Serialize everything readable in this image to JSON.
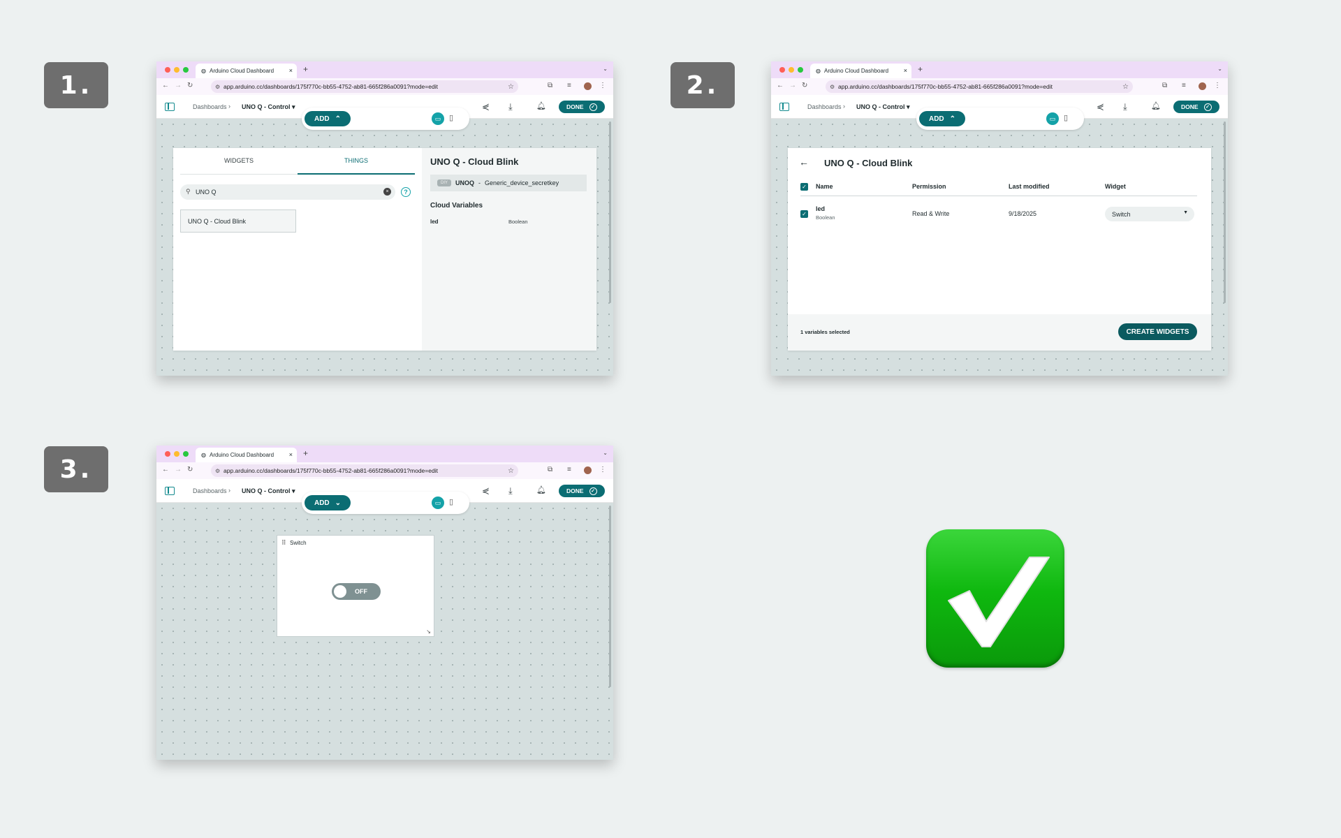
{
  "steps": [
    "1.",
    "2.",
    "3."
  ],
  "browser": {
    "tab_title": "Arduino Cloud Dashboard",
    "tab_close": "×",
    "new_tab": "+",
    "url": "app.arduino.cc/dashboards/175f770c-bb55-4752-ab81-665f286a0091?mode=edit"
  },
  "header": {
    "breadcrumb_root": "Dashboards",
    "breadcrumb_sep": "›",
    "dashboard_name": "UNO Q - Control ▾",
    "done_label": "DONE"
  },
  "add_bar": {
    "add_label": "ADD",
    "chevron_up": "⌃",
    "chevron_down": "⌄"
  },
  "panel1": {
    "tabs": [
      "WIDGETS",
      "THINGS"
    ],
    "active_tab": "THINGS",
    "search_value": "UNO Q",
    "result_item": "UNO Q - Cloud Blink",
    "thing_title": "UNO Q - Cloud Blink",
    "device_badge": "DIY",
    "device_name": "UNOQ",
    "device_sep": "-",
    "device_key": "Generic_device_secretkey",
    "cloud_vars_title": "Cloud Variables",
    "variables": [
      {
        "name": "led",
        "type": "Boolean"
      }
    ]
  },
  "panel2": {
    "title": "UNO Q - Cloud Blink",
    "columns": [
      "Name",
      "Permission",
      "Last modified",
      "Widget"
    ],
    "rows": [
      {
        "name": "led",
        "type": "Boolean",
        "permission": "Read & Write",
        "modified": "9/18/2025",
        "widget": "Switch",
        "checked": true
      }
    ],
    "selected_count": "1 variables selected",
    "create_label": "CREATE WIDGETS"
  },
  "panel3": {
    "widget_title": "Switch",
    "toggle_state": "OFF"
  },
  "colors": {
    "accent": "#0b6d73",
    "tab_bar": "#eedcf8",
    "canvas": "#d5dfdf",
    "success": "#0fb80f"
  }
}
